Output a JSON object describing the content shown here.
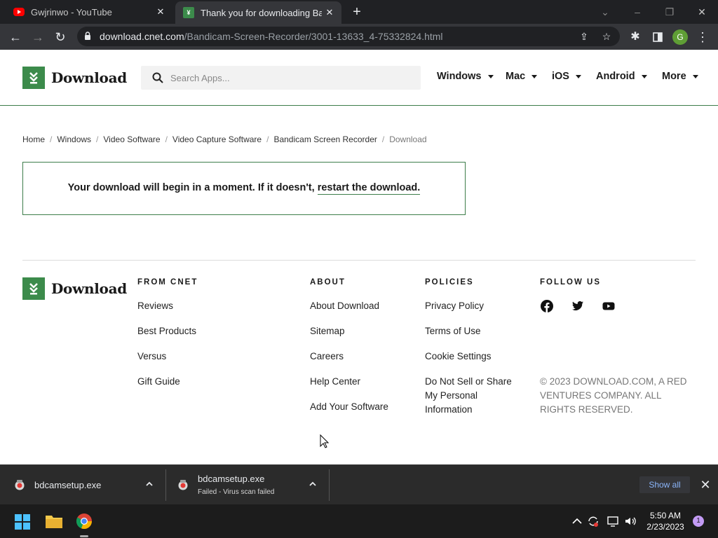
{
  "browser": {
    "tabs": [
      {
        "title": "Gwjrinwo - YouTube",
        "favicon": "youtube-icon",
        "active": false
      },
      {
        "title": "Thank you for downloading Bandicam",
        "favicon": "download-favicon",
        "active": true
      }
    ],
    "url_host": "download.cnet.com",
    "url_path": "/Bandicam-Screen-Recorder/3001-13633_4-75332824.html",
    "profile_initial": "G"
  },
  "site": {
    "logo_text": "Download",
    "search_placeholder": "Search Apps...",
    "nav": [
      "Windows",
      "Mac",
      "iOS",
      "Android",
      "More"
    ],
    "brand_color": "#3c8b4b"
  },
  "breadcrumb": [
    "Home",
    "Windows",
    "Video Software",
    "Video Capture Software",
    "Bandicam Screen Recorder",
    "Download"
  ],
  "notice": {
    "text": "Your download will begin in a moment. If it doesn't,",
    "link": "restart the download."
  },
  "footer": {
    "logo_text": "Download",
    "from_cnet": {
      "title": "FROM CNET",
      "links": [
        "Reviews",
        "Best Products",
        "Versus",
        "Gift Guide"
      ]
    },
    "about": {
      "title": "ABOUT",
      "links": [
        "About Download",
        "Sitemap",
        "Careers",
        "Help Center",
        "Add Your Software"
      ]
    },
    "policies": {
      "title": "POLICIES",
      "links": [
        "Privacy Policy",
        "Terms of Use",
        "Cookie Settings",
        "Do Not Sell or Share My Personal Information"
      ]
    },
    "follow": {
      "title": "FOLLOW US",
      "icons": [
        "facebook-icon",
        "twitter-icon",
        "youtube-icon"
      ]
    },
    "copyright": "© 2023 DOWNLOAD.COM, A RED VENTURES COMPANY. ALL RIGHTS RESERVED."
  },
  "downloads": {
    "items": [
      {
        "name": "bdcamsetup.exe",
        "status": ""
      },
      {
        "name": "bdcamsetup.exe",
        "status": "Failed - Virus scan failed"
      }
    ],
    "show_all": "Show all"
  },
  "taskbar": {
    "time": "5:50 AM",
    "date": "2/23/2023",
    "notification_count": "1"
  }
}
